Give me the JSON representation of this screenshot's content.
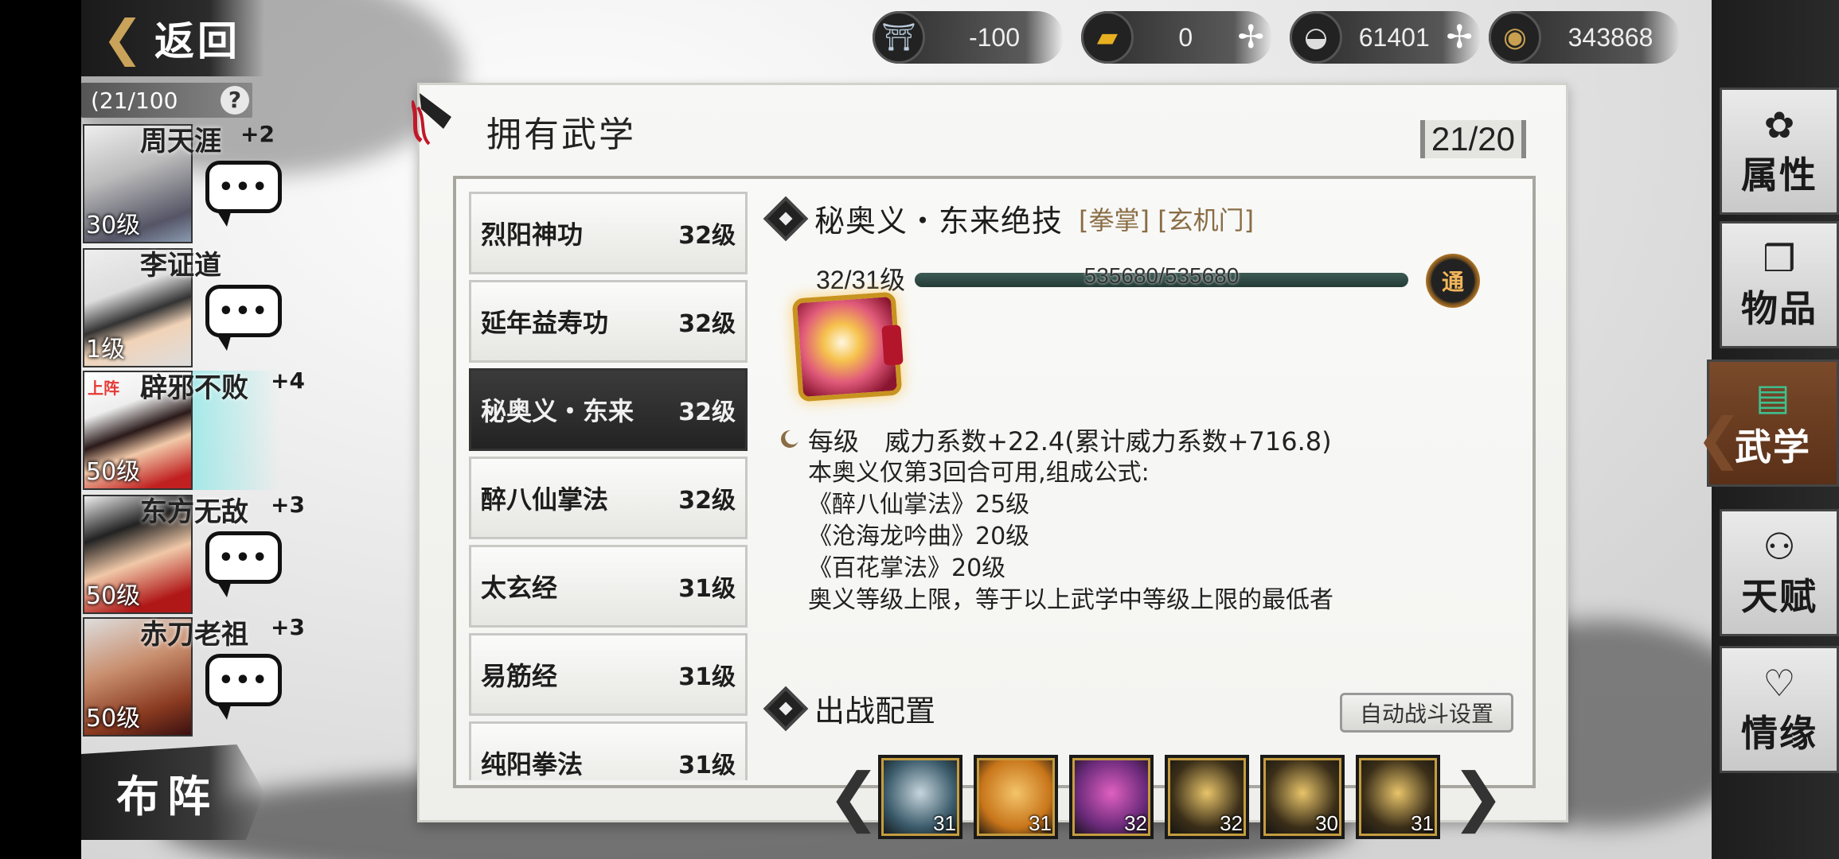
{
  "nav": {
    "back_label": "返回"
  },
  "resources": [
    {
      "icon": "cauldron-icon",
      "glyph": "⛩",
      "value": "-100",
      "has_plus": false
    },
    {
      "icon": "gold-bar-icon",
      "glyph": "▰",
      "value": "0",
      "has_plus": true
    },
    {
      "icon": "silver-ingot-icon",
      "glyph": "◒",
      "value": "61401",
      "has_plus": true
    },
    {
      "icon": "coin-icon",
      "glyph": "◉",
      "value": "343868",
      "has_plus": true
    }
  ],
  "plus_glyph": "✢",
  "roster": {
    "count_label": "(21/100",
    "help_glyph": "?",
    "heroes": [
      {
        "name": "周天涯",
        "bonus": "+2",
        "level": "30级",
        "deployed": false
      },
      {
        "name": "李证道",
        "bonus": "",
        "level": "1级",
        "deployed": false
      },
      {
        "name": "辟邪不败",
        "bonus": "+4",
        "level": "50级",
        "deployed": true,
        "deploy_label": "上阵"
      },
      {
        "name": "东方无敌",
        "bonus": "+3",
        "level": "50级",
        "deployed": false
      },
      {
        "name": "赤刀老祖",
        "bonus": "+3",
        "level": "50级",
        "deployed": false
      }
    ],
    "chat_glyph": "•••",
    "formation_label": "布阵"
  },
  "panel": {
    "title": "拥有武学",
    "count": "21/20",
    "skills": [
      {
        "name": "烈阳神功",
        "level": "32级",
        "selected": false
      },
      {
        "name": "延年益寿功",
        "level": "32级",
        "selected": false
      },
      {
        "name": "秘奥义・东来",
        "level": "32级",
        "selected": true
      },
      {
        "name": "醉八仙掌法",
        "level": "32级",
        "selected": false
      },
      {
        "name": "太玄经",
        "level": "31级",
        "selected": false
      },
      {
        "name": "易筋经",
        "level": "31级",
        "selected": false
      },
      {
        "name": "纯阳拳法",
        "level": "31级",
        "selected": false
      }
    ]
  },
  "detail": {
    "name": "秘奥义・东来绝技",
    "tags": "[拳掌] [玄机门]",
    "level": "32/31级",
    "exp_text": "535680/535680",
    "exp_ratio": 1.0,
    "badge": "通",
    "per_level_label": "每级",
    "per_level_value": "威力系数+22.4(累计威力系数+716.8)",
    "lines": [
      "本奥义仅第3回合可用,组成公式:",
      "《醉八仙掌法》25级",
      "《沧海龙吟曲》20级",
      "《百花掌法》20级",
      "奥义等级上限，等于以上武学中等级上限的最低者"
    ]
  },
  "battle": {
    "title": "出战配置",
    "auto_label": "自动战斗设置",
    "prev_glyph": "❮",
    "next_glyph": "❯",
    "slots": [
      {
        "num": "31",
        "bg": "#3a5a6a",
        "accent": "#c6d5dc"
      },
      {
        "num": "31",
        "bg": "#c8751a",
        "accent": "#f4c46a"
      },
      {
        "num": "32",
        "bg": "#6a2a7a",
        "accent": "#e060c0"
      },
      {
        "num": "32",
        "bg": "#3a2e18",
        "accent": "#e8c46a"
      },
      {
        "num": "30",
        "bg": "#3a2e18",
        "accent": "#e8c46a"
      },
      {
        "num": "31",
        "bg": "#3a2e18",
        "accent": "#e8c46a"
      }
    ]
  },
  "right_menu": [
    {
      "label": "属性",
      "glyph": "✿",
      "active": false
    },
    {
      "label": "物品",
      "glyph": "❒",
      "active": false
    },
    {
      "label": "武学",
      "glyph": "▤",
      "active": true
    },
    {
      "label": "天赋",
      "glyph": "⚇",
      "active": false
    },
    {
      "label": "情缘",
      "glyph": "♡",
      "active": false
    }
  ],
  "menu_pointer_glyph": "❮"
}
